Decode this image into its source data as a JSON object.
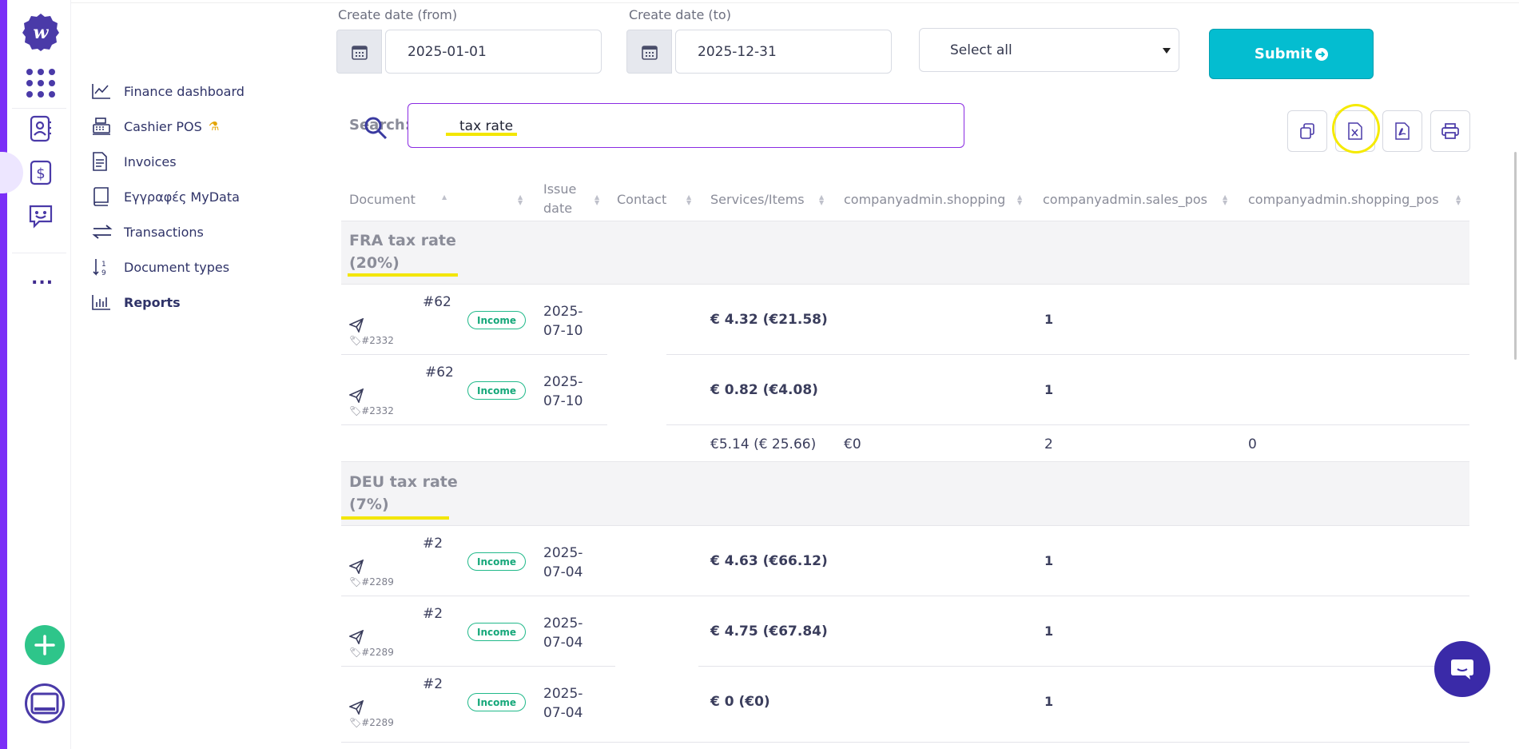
{
  "nav": {
    "items": [
      {
        "label": "Finance dashboard",
        "icon": "line-chart-icon"
      },
      {
        "label": "Cashier POS",
        "icon": "cash-register-icon"
      },
      {
        "label": "Invoices",
        "icon": "document-icon"
      },
      {
        "label": "Εγγραφές MyData",
        "icon": "book-icon"
      },
      {
        "label": "Transactions",
        "icon": "arrows-exchange-icon"
      },
      {
        "label": "Document types",
        "icon": "sort-numeric-icon"
      },
      {
        "label": "Reports",
        "icon": "bar-chart-icon"
      }
    ],
    "more": "..."
  },
  "filters": {
    "from_label": "Create date (from)",
    "from_value": "2025-01-01",
    "to_label": "Create date (to)",
    "to_value": "2025-12-31",
    "select_value": "Select all",
    "submit_label": "Submit"
  },
  "search": {
    "label": "Search:",
    "value": "tax rate"
  },
  "table": {
    "columns": [
      "Document",
      "Issue date",
      "Contact",
      "Services/Items",
      "companyadmin.shopping",
      "companyadmin.sales_pos",
      "companyadmin.shopping_pos"
    ],
    "groups": [
      {
        "title_line1": "FRA tax rate",
        "title_line2": "(20%)",
        "rows": [
          {
            "number": "#62",
            "tag": "#2332",
            "type": "Income",
            "date_line1": "2025-",
            "date_line2": "07-10",
            "amount": "€ 4.32 (€21.58)",
            "qty": "1"
          },
          {
            "number": "#62",
            "tag": "#2332",
            "type": "Income",
            "date_line1": "2025-",
            "date_line2": "07-10",
            "amount": "€ 0.82 (€4.08)",
            "qty": "1"
          }
        ],
        "totals": {
          "services": "€5.14 (€ 25.66)",
          "shopping": "€0",
          "sales_pos": "2",
          "shopping_pos": "0"
        }
      },
      {
        "title_line1": "DEU tax rate",
        "title_line2": "(7%)",
        "rows": [
          {
            "number": "#2",
            "tag": "#2289",
            "type": "Income",
            "date_line1": "2025-",
            "date_line2": "07-04",
            "amount": "€ 4.63 (€66.12)",
            "qty": "1"
          },
          {
            "number": "#2",
            "tag": "#2289",
            "type": "Income",
            "date_line1": "2025-",
            "date_line2": "07-04",
            "amount": "€ 4.75 (€67.84)",
            "qty": "1"
          },
          {
            "number": "#2",
            "tag": "#2289",
            "type": "Income",
            "date_line1": "2025-",
            "date_line2": "07-04",
            "amount": "€ 0 (€0)",
            "qty": "1"
          }
        ]
      }
    ]
  },
  "colors": {
    "brand": "#4a3aa8",
    "accent_stripe": "#7b2ff7",
    "submit": "#04bdd0",
    "income": "#21b98a",
    "highlight": "#f3e600"
  }
}
